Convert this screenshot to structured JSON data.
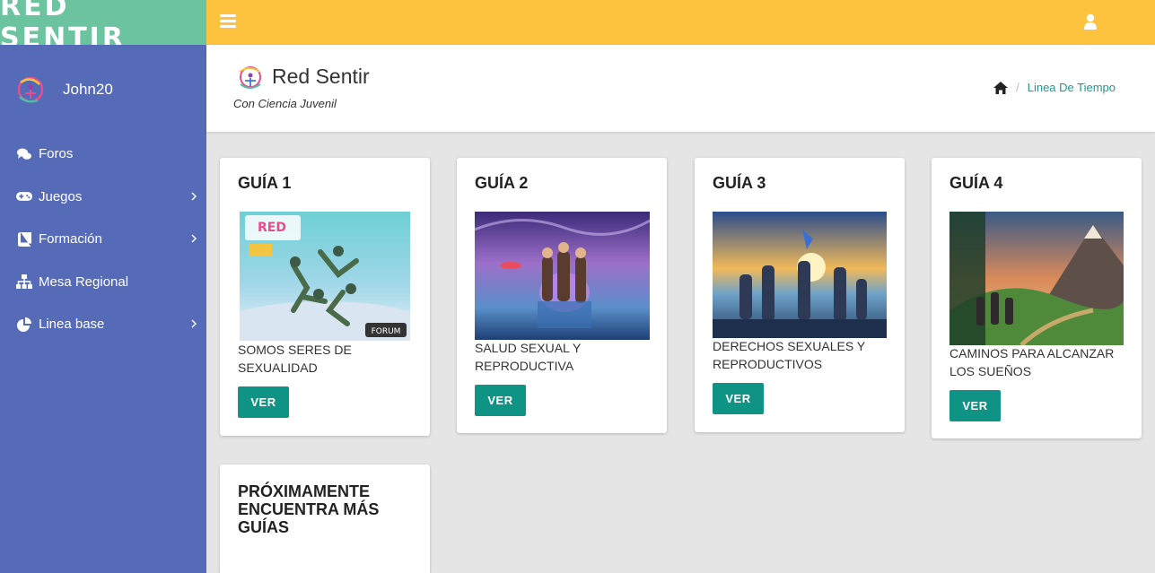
{
  "app": {
    "brand": "RED SENTIR"
  },
  "topbar": {
    "menu_icon": "hamburger-icon",
    "user_icon": "user-icon"
  },
  "sidebar": {
    "user": {
      "name": "John20",
      "avatar_icon": "logo-avatar"
    },
    "items": [
      {
        "label": "Foros",
        "icon": "comments-icon",
        "has_children": false
      },
      {
        "label": "Juegos",
        "icon": "gamepad-icon",
        "has_children": true
      },
      {
        "label": "Formación",
        "icon": "book-icon",
        "has_children": true
      },
      {
        "label": "Mesa Regional",
        "icon": "sitemap-icon",
        "has_children": false
      },
      {
        "label": "Linea base",
        "icon": "pie-chart-icon",
        "has_children": true
      }
    ]
  },
  "header": {
    "title": "Red Sentir",
    "subtitle": "Con Ciencia Juvenil",
    "breadcrumb": {
      "home_icon": "home-icon",
      "current": "Linea De Tiempo"
    }
  },
  "guides": [
    {
      "title": "GUÍA 1",
      "description": "SOMOS SERES DE SEXUALIDAD",
      "button": "VER"
    },
    {
      "title": "GUÍA 2",
      "description": "SALUD SEXUAL Y REPRODUCTIVA",
      "button": "VER"
    },
    {
      "title": "GUÍA 3",
      "description": "DERECHOS SEXUALES Y REPRODUCTIVOS",
      "button": "VER"
    },
    {
      "title": "GUÍA 4",
      "description": "CAMINOS PARA ALCANZAR LOS SUEÑOS",
      "button": "VER"
    }
  ],
  "coming_soon": {
    "title": "PRÓXIMAMENTE ENCUENTRA MÁS GUÍAS"
  },
  "colors": {
    "brand": "#6cc3a0",
    "topbar": "#fdc23e",
    "sidebar": "#566bb7",
    "button": "#0f9384",
    "link": "#1a9a8e"
  }
}
